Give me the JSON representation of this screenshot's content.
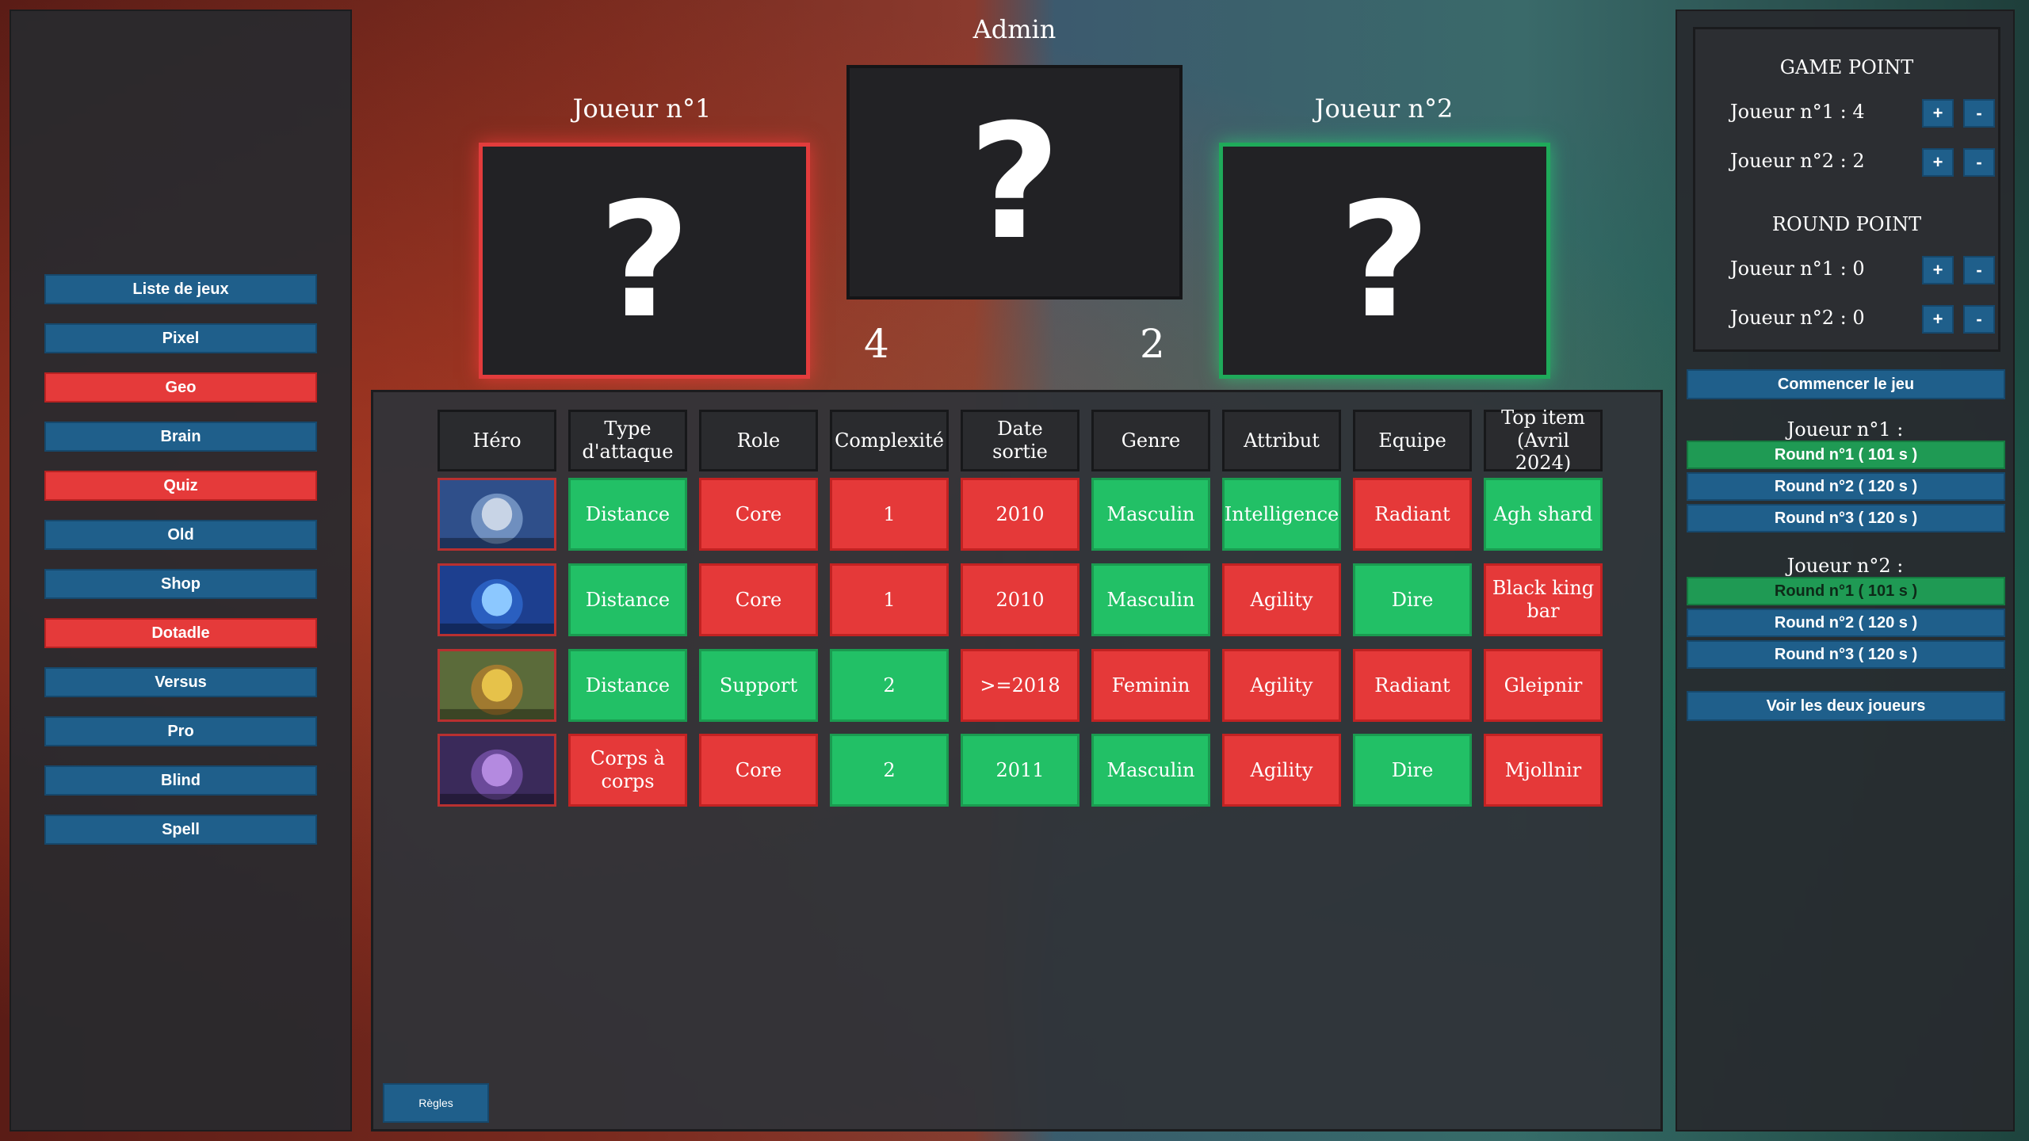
{
  "title": "Admin",
  "sidebar": {
    "items": [
      {
        "label": "Liste de jeux",
        "active": false
      },
      {
        "label": "Pixel",
        "active": false
      },
      {
        "label": "Geo",
        "active": true
      },
      {
        "label": "Brain",
        "active": false
      },
      {
        "label": "Quiz",
        "active": true
      },
      {
        "label": "Old",
        "active": false
      },
      {
        "label": "Shop",
        "active": false
      },
      {
        "label": "Dotadle",
        "active": true
      },
      {
        "label": "Versus",
        "active": false
      },
      {
        "label": "Pro",
        "active": false
      },
      {
        "label": "Blind",
        "active": false
      },
      {
        "label": "Spell",
        "active": false
      }
    ]
  },
  "players": {
    "p1": {
      "name": "Joueur n°1",
      "score": "4",
      "card": "?"
    },
    "p2": {
      "name": "Joueur n°2",
      "score": "2",
      "card": "?"
    },
    "center_card": "?"
  },
  "table": {
    "headers": [
      "Héro",
      "Type d'attaque",
      "Role",
      "Complexité",
      "Date sortie",
      "Genre",
      "Attribut",
      "Equipe",
      "Top item (Avril 2024)"
    ],
    "rows": [
      {
        "hero_icon": "zeus-portrait",
        "cells": [
          {
            "text": "Distance",
            "status": "green"
          },
          {
            "text": "Core",
            "status": "red"
          },
          {
            "text": "1",
            "status": "red"
          },
          {
            "text": "2010",
            "status": "red"
          },
          {
            "text": "Masculin",
            "status": "green"
          },
          {
            "text": "Intelligence",
            "status": "green"
          },
          {
            "text": "Radiant",
            "status": "red"
          },
          {
            "text": "Agh shard",
            "status": "green"
          }
        ]
      },
      {
        "hero_icon": "razor-portrait",
        "cells": [
          {
            "text": "Distance",
            "status": "green"
          },
          {
            "text": "Core",
            "status": "red"
          },
          {
            "text": "1",
            "status": "red"
          },
          {
            "text": "2010",
            "status": "red"
          },
          {
            "text": "Masculin",
            "status": "green"
          },
          {
            "text": "Agility",
            "status": "red"
          },
          {
            "text": "Dire",
            "status": "green"
          },
          {
            "text": "Black king bar",
            "status": "red"
          }
        ]
      },
      {
        "hero_icon": "hoodwink-portrait",
        "cells": [
          {
            "text": "Distance",
            "status": "green"
          },
          {
            "text": "Support",
            "status": "green"
          },
          {
            "text": "2",
            "status": "green"
          },
          {
            "text": ">=2018",
            "status": "red"
          },
          {
            "text": "Feminin",
            "status": "red"
          },
          {
            "text": "Agility",
            "status": "red"
          },
          {
            "text": "Radiant",
            "status": "red"
          },
          {
            "text": "Gleipnir",
            "status": "red"
          }
        ]
      },
      {
        "hero_icon": "faceless-void-portrait",
        "cells": [
          {
            "text": "Corps à corps",
            "status": "red"
          },
          {
            "text": "Core",
            "status": "red"
          },
          {
            "text": "2",
            "status": "green"
          },
          {
            "text": "2011",
            "status": "green"
          },
          {
            "text": "Masculin",
            "status": "green"
          },
          {
            "text": "Agility",
            "status": "red"
          },
          {
            "text": "Dire",
            "status": "green"
          },
          {
            "text": "Mjollnir",
            "status": "red"
          }
        ]
      }
    ]
  },
  "rules_label": "Règles",
  "right_panel": {
    "game_point_title": "GAME POINT",
    "game_points": [
      "Joueur n°1 : 4",
      "Joueur n°2 : 2"
    ],
    "round_point_title": "ROUND POINT",
    "round_points": [
      "Joueur n°1 : 0",
      "Joueur n°2 : 0"
    ],
    "plus": "+",
    "minus": "-",
    "start_label": "Commencer le jeu",
    "p1_label": "Joueur n°1 :",
    "p1_rounds": [
      {
        "label": "Round n°1 ( 101 s )",
        "done": true
      },
      {
        "label": "Round n°2 ( 120 s )",
        "done": false
      },
      {
        "label": "Round n°3 ( 120 s )",
        "done": false
      }
    ],
    "p2_label": "Joueur n°2 :",
    "p2_rounds": [
      {
        "label": "Round n°1 ( 101 s )",
        "done": true
      },
      {
        "label": "Round n°2 ( 120 s )",
        "done": false
      },
      {
        "label": "Round n°3 ( 120 s )",
        "done": false
      }
    ],
    "both_label": "Voir les deux joueurs"
  },
  "colors": {
    "correct": "#22c066",
    "wrong": "#e53939",
    "button": "#1f5f8b",
    "p1_accent": "#e23c3c",
    "p2_accent": "#1faa5a"
  }
}
